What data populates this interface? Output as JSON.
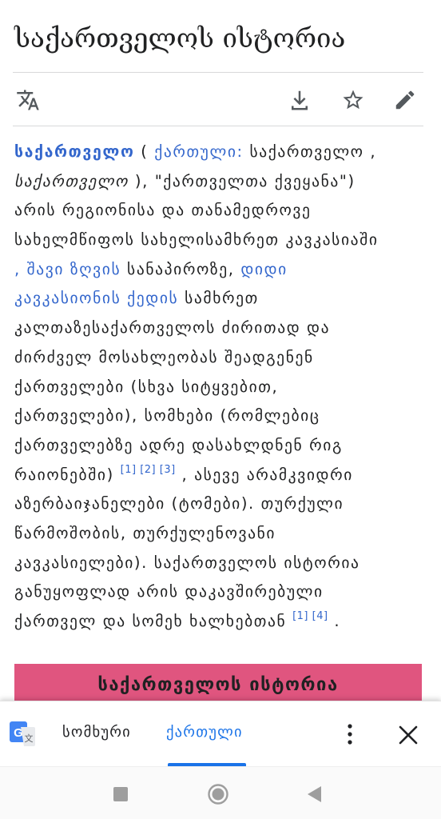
{
  "page": {
    "title": "საქართველოს ისტორია"
  },
  "actions": {
    "language_icon": "translate-icon",
    "download_icon": "download-icon",
    "watch_icon": "star-icon",
    "edit_icon": "pencil-icon"
  },
  "article": {
    "l1": {
      "a": "საქართველო",
      "b": " ( ",
      "c": "ქართული:",
      "d": " საქართველო ,"
    },
    "l2": {
      "a": "საქართველო",
      "b": " ), \"ქართველთა ქვეყანა\")"
    },
    "l3": {
      "a": "არის რეგიონისა და თანამედროვე"
    },
    "l4": {
      "a": "სახელმწიფოს სახელისამხრეთ კავკასიაში"
    },
    "l5": {
      "a": ", შავი ზღვის",
      "b": " სანაპიროზე, ",
      "c": "დიდი"
    },
    "l6": {
      "a": "კავკასიონის ქედის",
      "b": " სამხრეთ"
    },
    "l7": {
      "a": "კალთაზესაქართველოს ძირითად და"
    },
    "l8": {
      "a": "ძირძველ მოსახლეობას შეადგენენ"
    },
    "l9": {
      "a": "ქართველები (სხვა სიტყვებით,"
    },
    "l10": {
      "a": "ქართველები), სომხები (რომლებიც"
    },
    "l11": {
      "a": "ქართველებზე ადრე დასახლდნენ რიგ"
    },
    "l12": {
      "a": "რაიონებში)",
      "r1": "[1]",
      "r2": "[2]",
      "r3": "[3]",
      "b": " , ასევე არამკვიდრი"
    },
    "l13": {
      "a": "აზერბაიჯანელები (ტომები). თურქული"
    },
    "l14": {
      "a": "წარმოშობის, თურქულენოვანი"
    },
    "l15": {
      "a": "კავკასიელები). საქართველოს ისტორია"
    },
    "l16": {
      "a": "განუყოფლად არის დაკავშირებული"
    },
    "l17": {
      "a": "ქართველ და სომეხ ხალხებთან",
      "r1": "[1]",
      "r2": "[4]",
      "b": " ."
    }
  },
  "infobox": {
    "title": "საქართველოს ისტორია",
    "color": "#e0557f"
  },
  "translate_bar": {
    "icon": "google-translate-icon",
    "source_lang": "სომხური",
    "target_lang": "ქართული",
    "accent": "#1a73e8"
  },
  "navbar": {
    "recents_icon": "recents-square-icon",
    "home_icon": "home-circle-icon",
    "back_icon": "back-triangle-icon"
  }
}
